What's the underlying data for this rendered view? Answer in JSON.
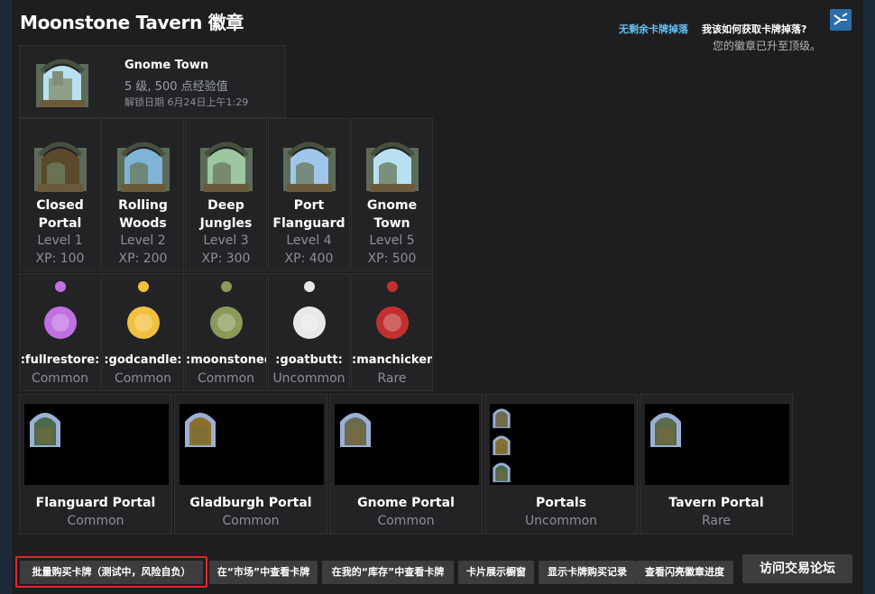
{
  "header": {
    "title": "Moonstone Tavern 徽章",
    "no_drops_link": "无剩余卡牌掉落",
    "how_to_link": "我该如何获取卡牌掉落?",
    "max_level_text": "您的徽章已升至顶级。",
    "help_icon": "steam-help-icon"
  },
  "current_badge": {
    "name": "Gnome Town",
    "level_xp": "5 级, 500 点经验值",
    "unlock_date": "解锁日期 6月24日上午1:29"
  },
  "levels": [
    {
      "name": "Closed\nPortal",
      "level": "Level 1",
      "xp": "XP: 100",
      "sky": "#5a4a2a"
    },
    {
      "name": "Rolling\nWoods",
      "level": "Level 2",
      "xp": "XP: 200",
      "sky": "#7fb4d8"
    },
    {
      "name": "Deep\nJungles",
      "level": "Level 3",
      "xp": "XP: 300",
      "sky": "#9cc7a0"
    },
    {
      "name": "Port\nFlanguard",
      "level": "Level 4",
      "xp": "XP: 400",
      "sky": "#9fc6ea"
    },
    {
      "name": "Gnome\nTown",
      "level": "Level 5",
      "xp": "XP: 500",
      "sky": "#b9e0f0"
    }
  ],
  "emoticons": [
    {
      "name": ":fullrestore:",
      "rarity": "Common",
      "color": "#c070e0"
    },
    {
      "name": ":godcandle:",
      "rarity": "Common",
      "color": "#f0c040"
    },
    {
      "name": ":moonstoned:",
      "rarity": "Common",
      "color": "#8a9a5a"
    },
    {
      "name": ":goatbutt:",
      "rarity": "Uncommon",
      "color": "#e8e8e8"
    },
    {
      "name": ":manchicken:",
      "rarity": "Rare",
      "color": "#c03030"
    }
  ],
  "cards": [
    {
      "name": "Flanguard Portal",
      "rarity": "Common"
    },
    {
      "name": "Gladburgh Portal",
      "rarity": "Common"
    },
    {
      "name": "Gnome Portal",
      "rarity": "Common"
    },
    {
      "name": "Portals",
      "rarity": "Uncommon"
    },
    {
      "name": "Tavern Portal",
      "rarity": "Rare"
    }
  ],
  "footer": {
    "bulk_buy": "批量购买卡牌（测试中，风险自负）",
    "view_market": "在“市场”中查看卡牌",
    "view_inventory": "在我的“库存”中查看卡牌",
    "showcase": "卡片展示橱窗",
    "purchase_history": "显示卡牌购买记录",
    "foil_progress": "查看闪亮徽章进度",
    "trade_forum": "访问交易论坛"
  },
  "colors": {
    "accent": "#66c0f4",
    "highlight": "#e0262a"
  }
}
